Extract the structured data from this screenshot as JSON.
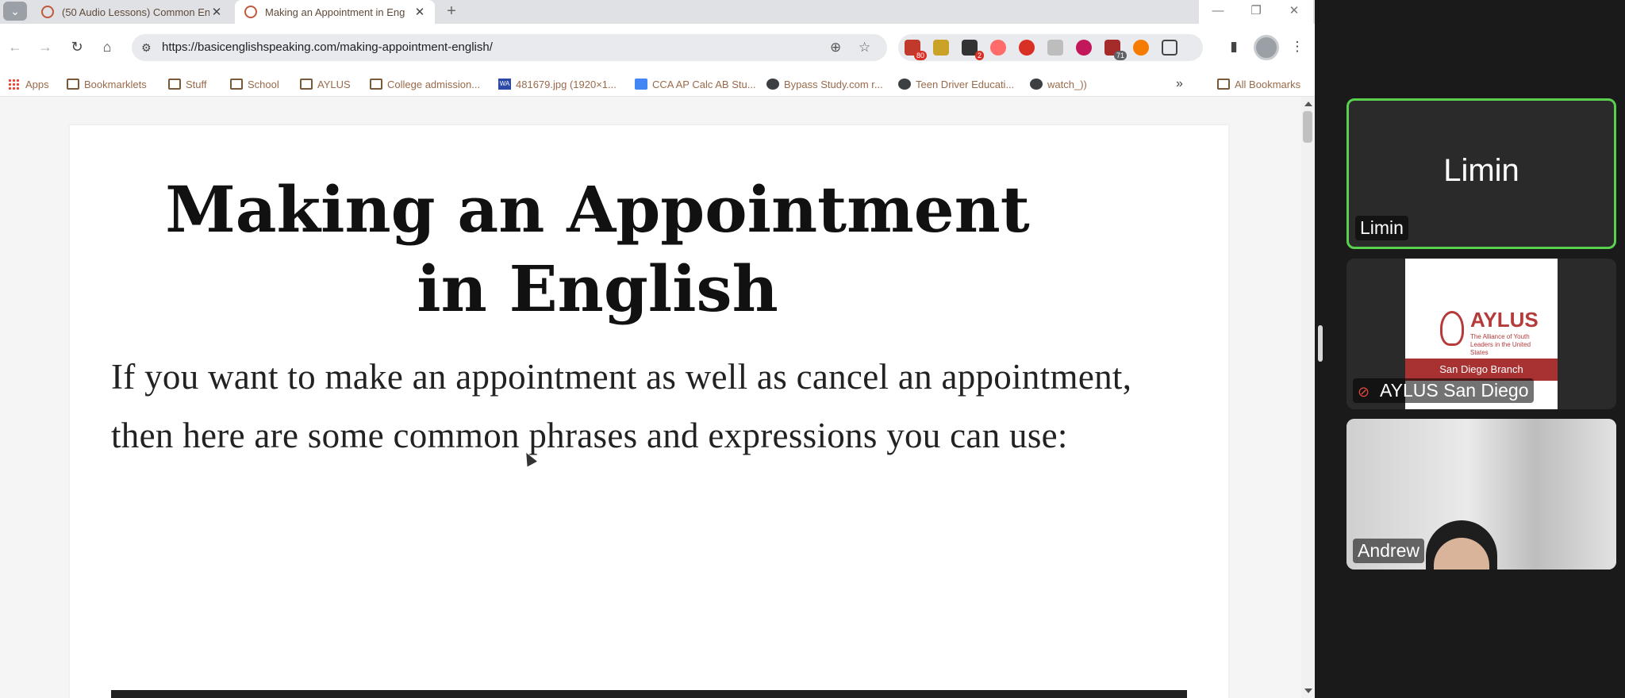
{
  "browser": {
    "tabs": [
      {
        "title": "(50 Audio Lessons) Common En",
        "active": false
      },
      {
        "title": "Making an Appointment in Eng",
        "active": true
      }
    ],
    "url": "https://basicenglishspeaking.com/making-appointment-english/",
    "extensions": [
      {
        "name": "mail-extension-icon",
        "badge": "80"
      },
      {
        "name": "yellow-extension-icon",
        "badge": ""
      },
      {
        "name": "badge-extension-icon",
        "badge": "2"
      },
      {
        "name": "red-record-icon",
        "badge": ""
      },
      {
        "name": "red-clock-icon",
        "badge": ""
      },
      {
        "name": "grey-extension-icon",
        "badge": ""
      },
      {
        "name": "play-circle-icon",
        "badge": ""
      },
      {
        "name": "calendar-extension-icon",
        "badge": "71"
      },
      {
        "name": "orange-extension-icon",
        "badge": ""
      },
      {
        "name": "puzzle-icon",
        "badge": ""
      }
    ],
    "bookmarks": [
      {
        "label": "Apps",
        "icon": "apps-icon"
      },
      {
        "label": "Bookmarklets",
        "icon": "folder-icon"
      },
      {
        "label": "Stuff",
        "icon": "folder-icon"
      },
      {
        "label": "School",
        "icon": "folder-icon"
      },
      {
        "label": "AYLUS",
        "icon": "folder-icon"
      },
      {
        "label": "College admission...",
        "icon": "folder-icon"
      },
      {
        "label": "481679.jpg (1920×1...",
        "icon": "image-icon"
      },
      {
        "label": "CCA AP Calc AB Stu...",
        "icon": "doc-icon"
      },
      {
        "label": "Bypass Study.com r...",
        "icon": "globe-icon"
      },
      {
        "label": "Teen Driver Educati...",
        "icon": "globe-icon"
      },
      {
        "label": "watch_))",
        "icon": "globe-icon"
      }
    ],
    "all_bookmarks": "All Bookmarks"
  },
  "article": {
    "title": "Making an Appointment in English",
    "intro": "If you want to make an appointment as well as cancel an appointment, then here are some common phrases and expressions you can use:"
  },
  "meeting": {
    "participants": [
      {
        "name": "Limin",
        "display": "Limin",
        "speaking": true
      },
      {
        "name": "AYLUS San Diego",
        "logo_word": "AYLUS",
        "logo_tagline": "The Alliance of Youth Leaders in the United States",
        "branch": "San Diego Branch",
        "muted": true
      },
      {
        "name": "Andrew"
      }
    ]
  }
}
